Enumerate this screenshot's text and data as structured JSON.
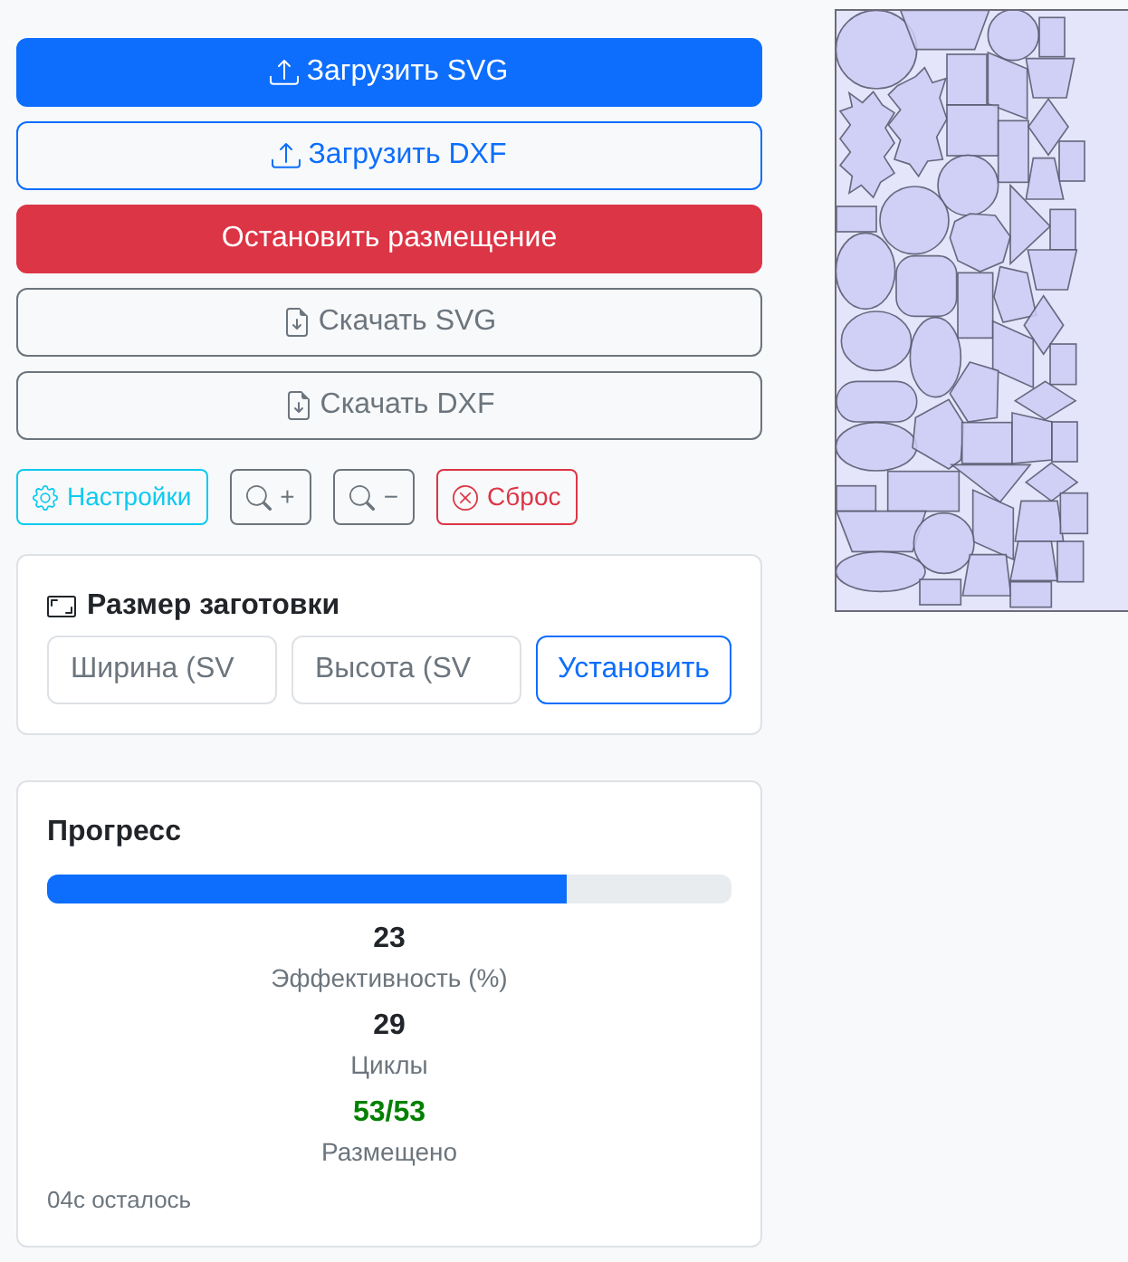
{
  "actions": [
    {
      "label": "Загрузить SVG",
      "kind": "upload",
      "filled": true
    },
    {
      "label": "Загрузить DXF",
      "kind": "upload",
      "filled": false
    },
    {
      "label": "Остановить размещение",
      "kind": "stop",
      "filled": true
    },
    {
      "label": "Скачать SVG",
      "kind": "download",
      "filled": false
    },
    {
      "label": "Скачать DXF",
      "kind": "download",
      "filled": false
    }
  ],
  "toolbar": [
    {
      "label": "Настройки",
      "kind": "settings"
    },
    {
      "label": "+",
      "kind": "zoom-in"
    },
    {
      "label": "−",
      "kind": "zoom-out"
    },
    {
      "label": "Сброс",
      "kind": "reset"
    }
  ],
  "sheet_size": {
    "title": "Размер заготовки",
    "fields": [
      {
        "placeholder": "Ширина (SV"
      },
      {
        "placeholder": "Высота (SV"
      }
    ],
    "button": "Установить"
  },
  "progress": {
    "title": "Прогресс",
    "level": 0.76,
    "stats": [
      {
        "value": "23",
        "label": "Эффективность (%)",
        "color": "#212529"
      },
      {
        "value": "29",
        "label": "Циклы",
        "color": "#212529"
      },
      {
        "value": "53/53",
        "label": "Размещено",
        "color": "#008000"
      }
    ],
    "remaining": "04с осталось"
  }
}
